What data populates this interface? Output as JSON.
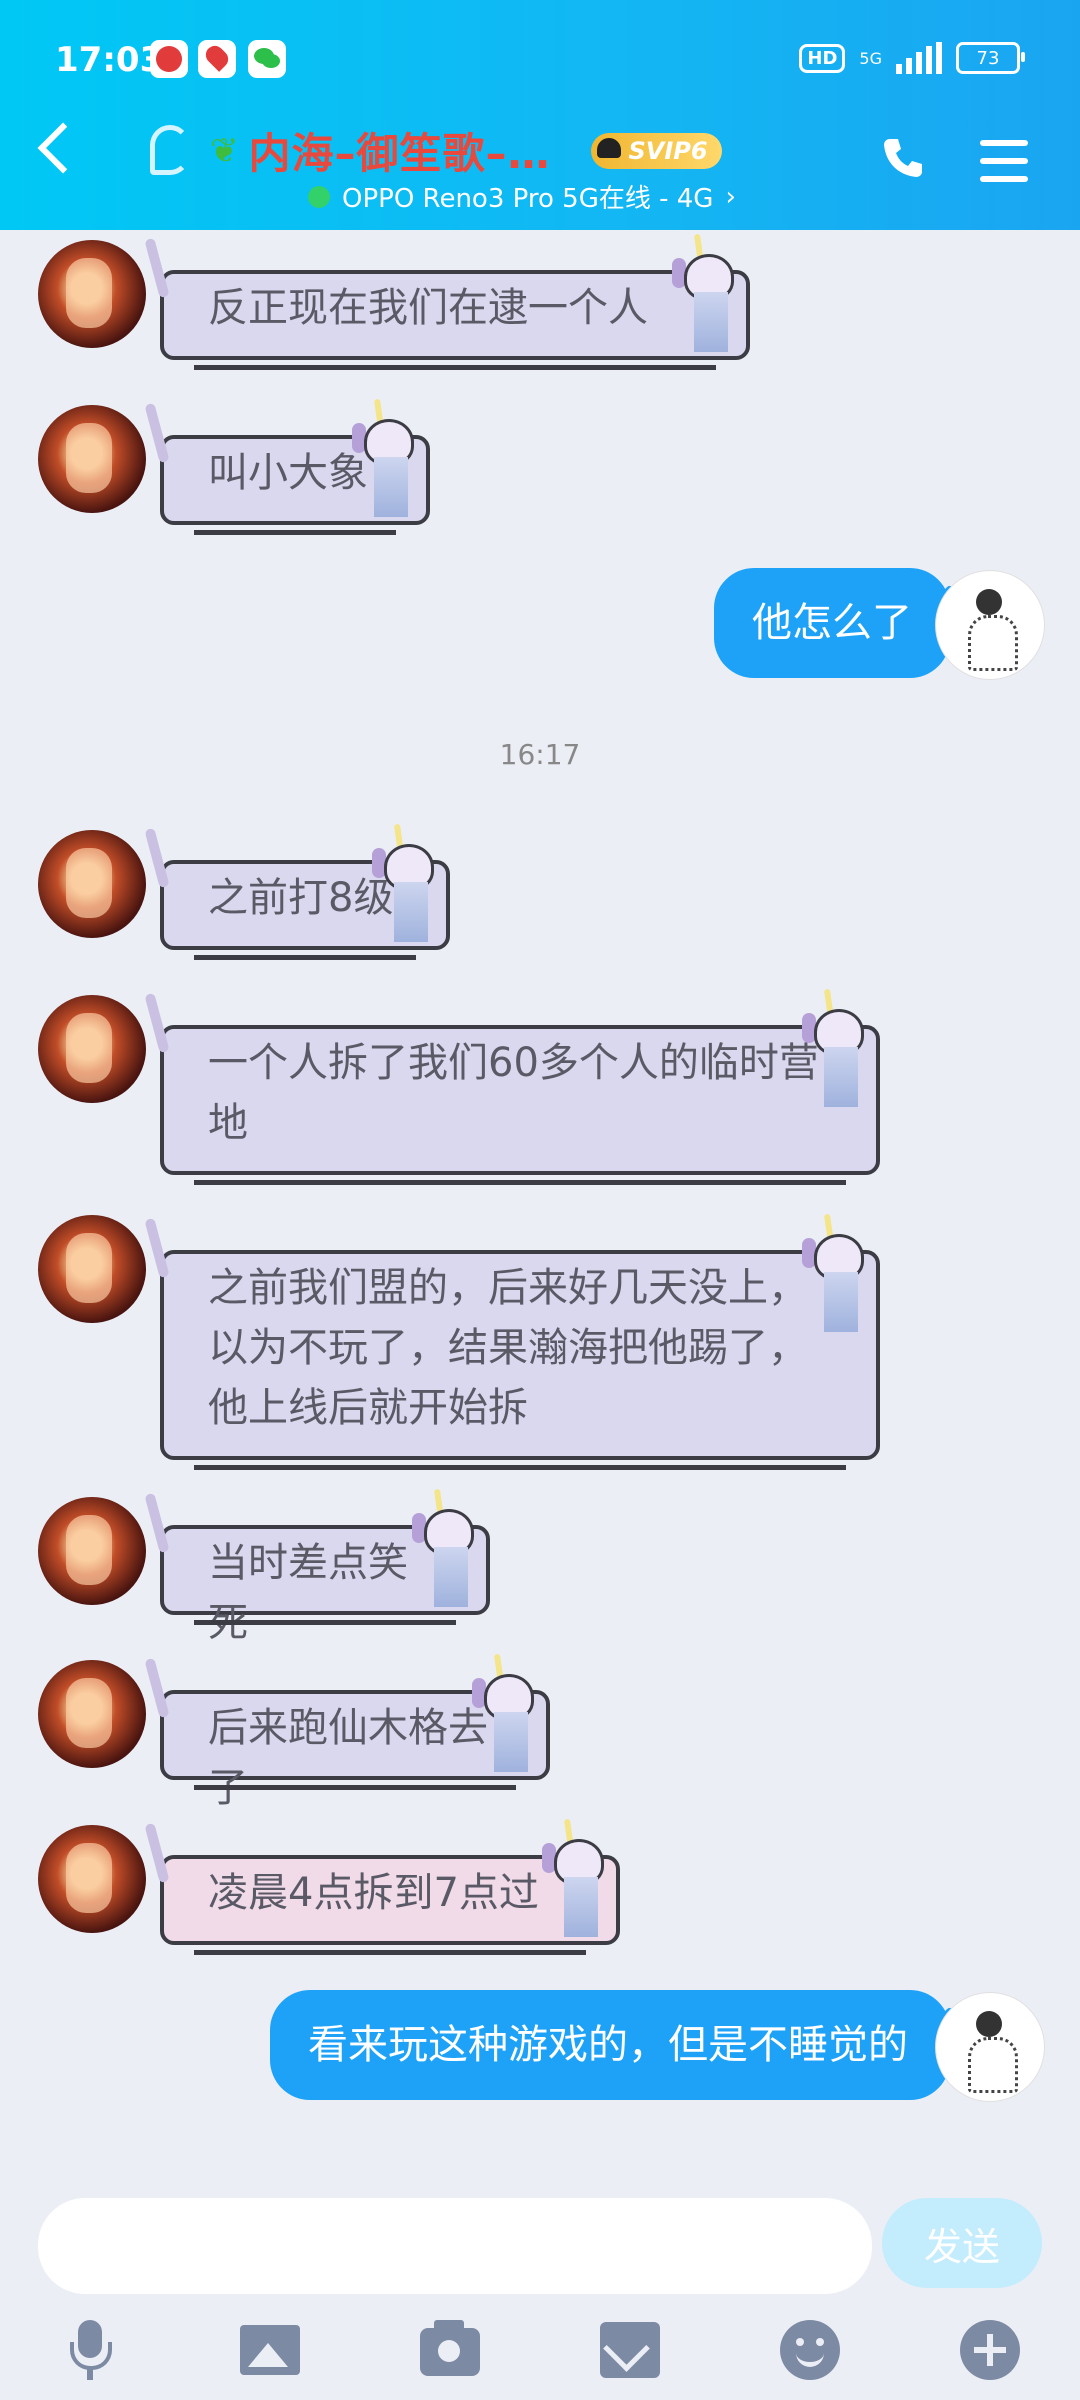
{
  "status_bar": {
    "time": "17:03",
    "hd": "HD",
    "network": "5G",
    "battery": "73"
  },
  "header": {
    "title": "内海–御笙歌–…",
    "vip_badge": "SVIP6",
    "subtitle": "OPPO Reno3 Pro 5G在线 - 4G",
    "subtitle_chevron": "›"
  },
  "messages": [
    {
      "side": "left",
      "text": "反正现在我们在逮一个人"
    },
    {
      "side": "left",
      "text": "叫小大象"
    },
    {
      "side": "right",
      "text": "他怎么了"
    },
    {
      "type": "timestamp",
      "text": "16:17"
    },
    {
      "side": "left",
      "text": "之前打8级"
    },
    {
      "side": "left",
      "text": "一个人拆了我们60多个人的临时营地"
    },
    {
      "side": "left",
      "text": "之前我们盟的，后来好几天没上，以为不玩了，结果瀚海把他踢了，他上线后就开始拆"
    },
    {
      "side": "left",
      "text": "当时差点笑死"
    },
    {
      "side": "left",
      "text": "后来跑仙木格去了"
    },
    {
      "side": "left",
      "text": "凌晨4点拆到7点过"
    },
    {
      "side": "right",
      "text": "看来玩这种游戏的，但是不睡觉的"
    }
  ],
  "input": {
    "value": "",
    "send_label": "发送"
  },
  "toolbar_icons": [
    "mic-icon",
    "image-icon",
    "camera-icon",
    "red-packet-icon",
    "emoji-icon",
    "plus-icon"
  ],
  "colors": {
    "header_start": "#00c8f5",
    "header_end": "#1aa5f1",
    "title_color": "#e8493c",
    "bubble_right": "#1ea2f7",
    "send_disabled": "#c3ecfd"
  }
}
